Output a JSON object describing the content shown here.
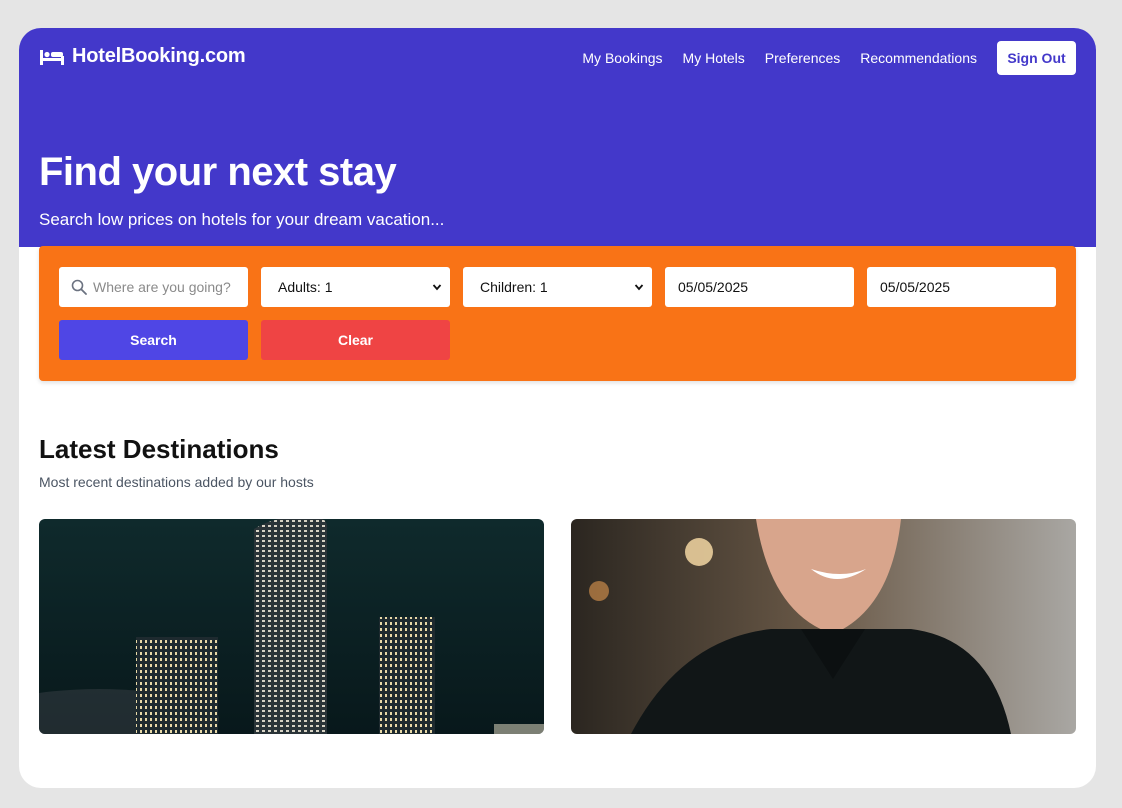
{
  "colors": {
    "brand": "#4338ca",
    "accent": "#f97316",
    "search_button": "#4f46e5",
    "clear_button": "#ef4444"
  },
  "header": {
    "logo_icon": "bed-icon",
    "logo_text": "HotelBooking.com",
    "nav": [
      "My Bookings",
      "My Hotels",
      "Preferences",
      "Recommendations"
    ],
    "sign_out": "Sign Out"
  },
  "hero": {
    "title": "Find your next stay",
    "subtitle": "Search low prices on hotels for your dream vacation..."
  },
  "search": {
    "destination_placeholder": "Where are you going?",
    "adults": "Adults: 1",
    "children": "Children: 1",
    "check_in": "05/05/2025",
    "check_out": "05/05/2025",
    "search_label": "Search",
    "clear_label": "Clear"
  },
  "destinations": {
    "title": "Latest Destinations",
    "subtitle": "Most recent destinations added by our hosts",
    "cards": [
      {
        "image": "city-skyline-night-photo"
      },
      {
        "image": "smiling-man-portrait-photo"
      }
    ]
  }
}
